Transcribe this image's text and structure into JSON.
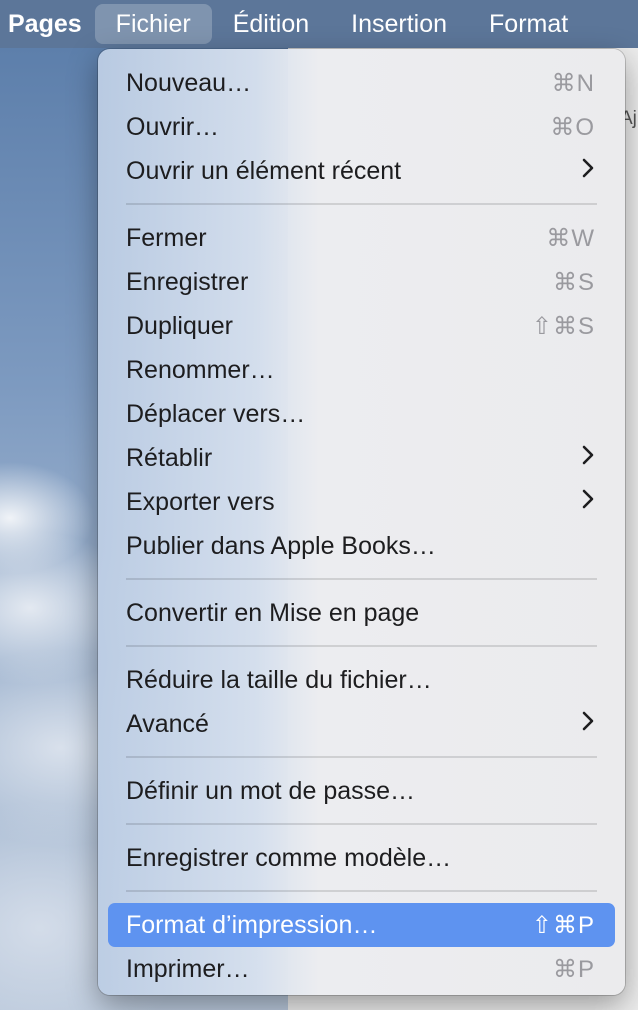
{
  "menubar": {
    "app": "Pages",
    "items": [
      "Fichier",
      "Édition",
      "Insertion",
      "Format"
    ]
  },
  "background": {
    "toolbar_fragment": "Aj"
  },
  "menu": {
    "groups": [
      [
        {
          "label": "Nouveau…",
          "shortcut": "⌘N"
        },
        {
          "label": "Ouvrir…",
          "shortcut": "⌘O"
        },
        {
          "label": "Ouvrir un élément récent",
          "submenu": true
        }
      ],
      [
        {
          "label": "Fermer",
          "shortcut": "⌘W"
        },
        {
          "label": "Enregistrer",
          "shortcut": "⌘S"
        },
        {
          "label": "Dupliquer",
          "shortcut": "⇧⌘S"
        },
        {
          "label": "Renommer…"
        },
        {
          "label": "Déplacer vers…"
        },
        {
          "label": "Rétablir",
          "submenu": true
        },
        {
          "label": "Exporter vers",
          "submenu": true
        },
        {
          "label": "Publier dans Apple Books…"
        }
      ],
      [
        {
          "label": "Convertir en Mise en page"
        }
      ],
      [
        {
          "label": "Réduire la taille du fichier…"
        },
        {
          "label": "Avancé",
          "submenu": true
        }
      ],
      [
        {
          "label": "Définir un mot de passe…"
        }
      ],
      [
        {
          "label": "Enregistrer comme modèle…"
        }
      ],
      [
        {
          "label": "Format d’impression…",
          "shortcut": "⇧⌘P",
          "highlighted": true
        },
        {
          "label": "Imprimer…",
          "shortcut": "⌘P"
        }
      ]
    ],
    "submenu_arrow": "chevron-right-icon"
  },
  "colors": {
    "highlight": "#5e93f0",
    "menubar": "#5c7699"
  }
}
